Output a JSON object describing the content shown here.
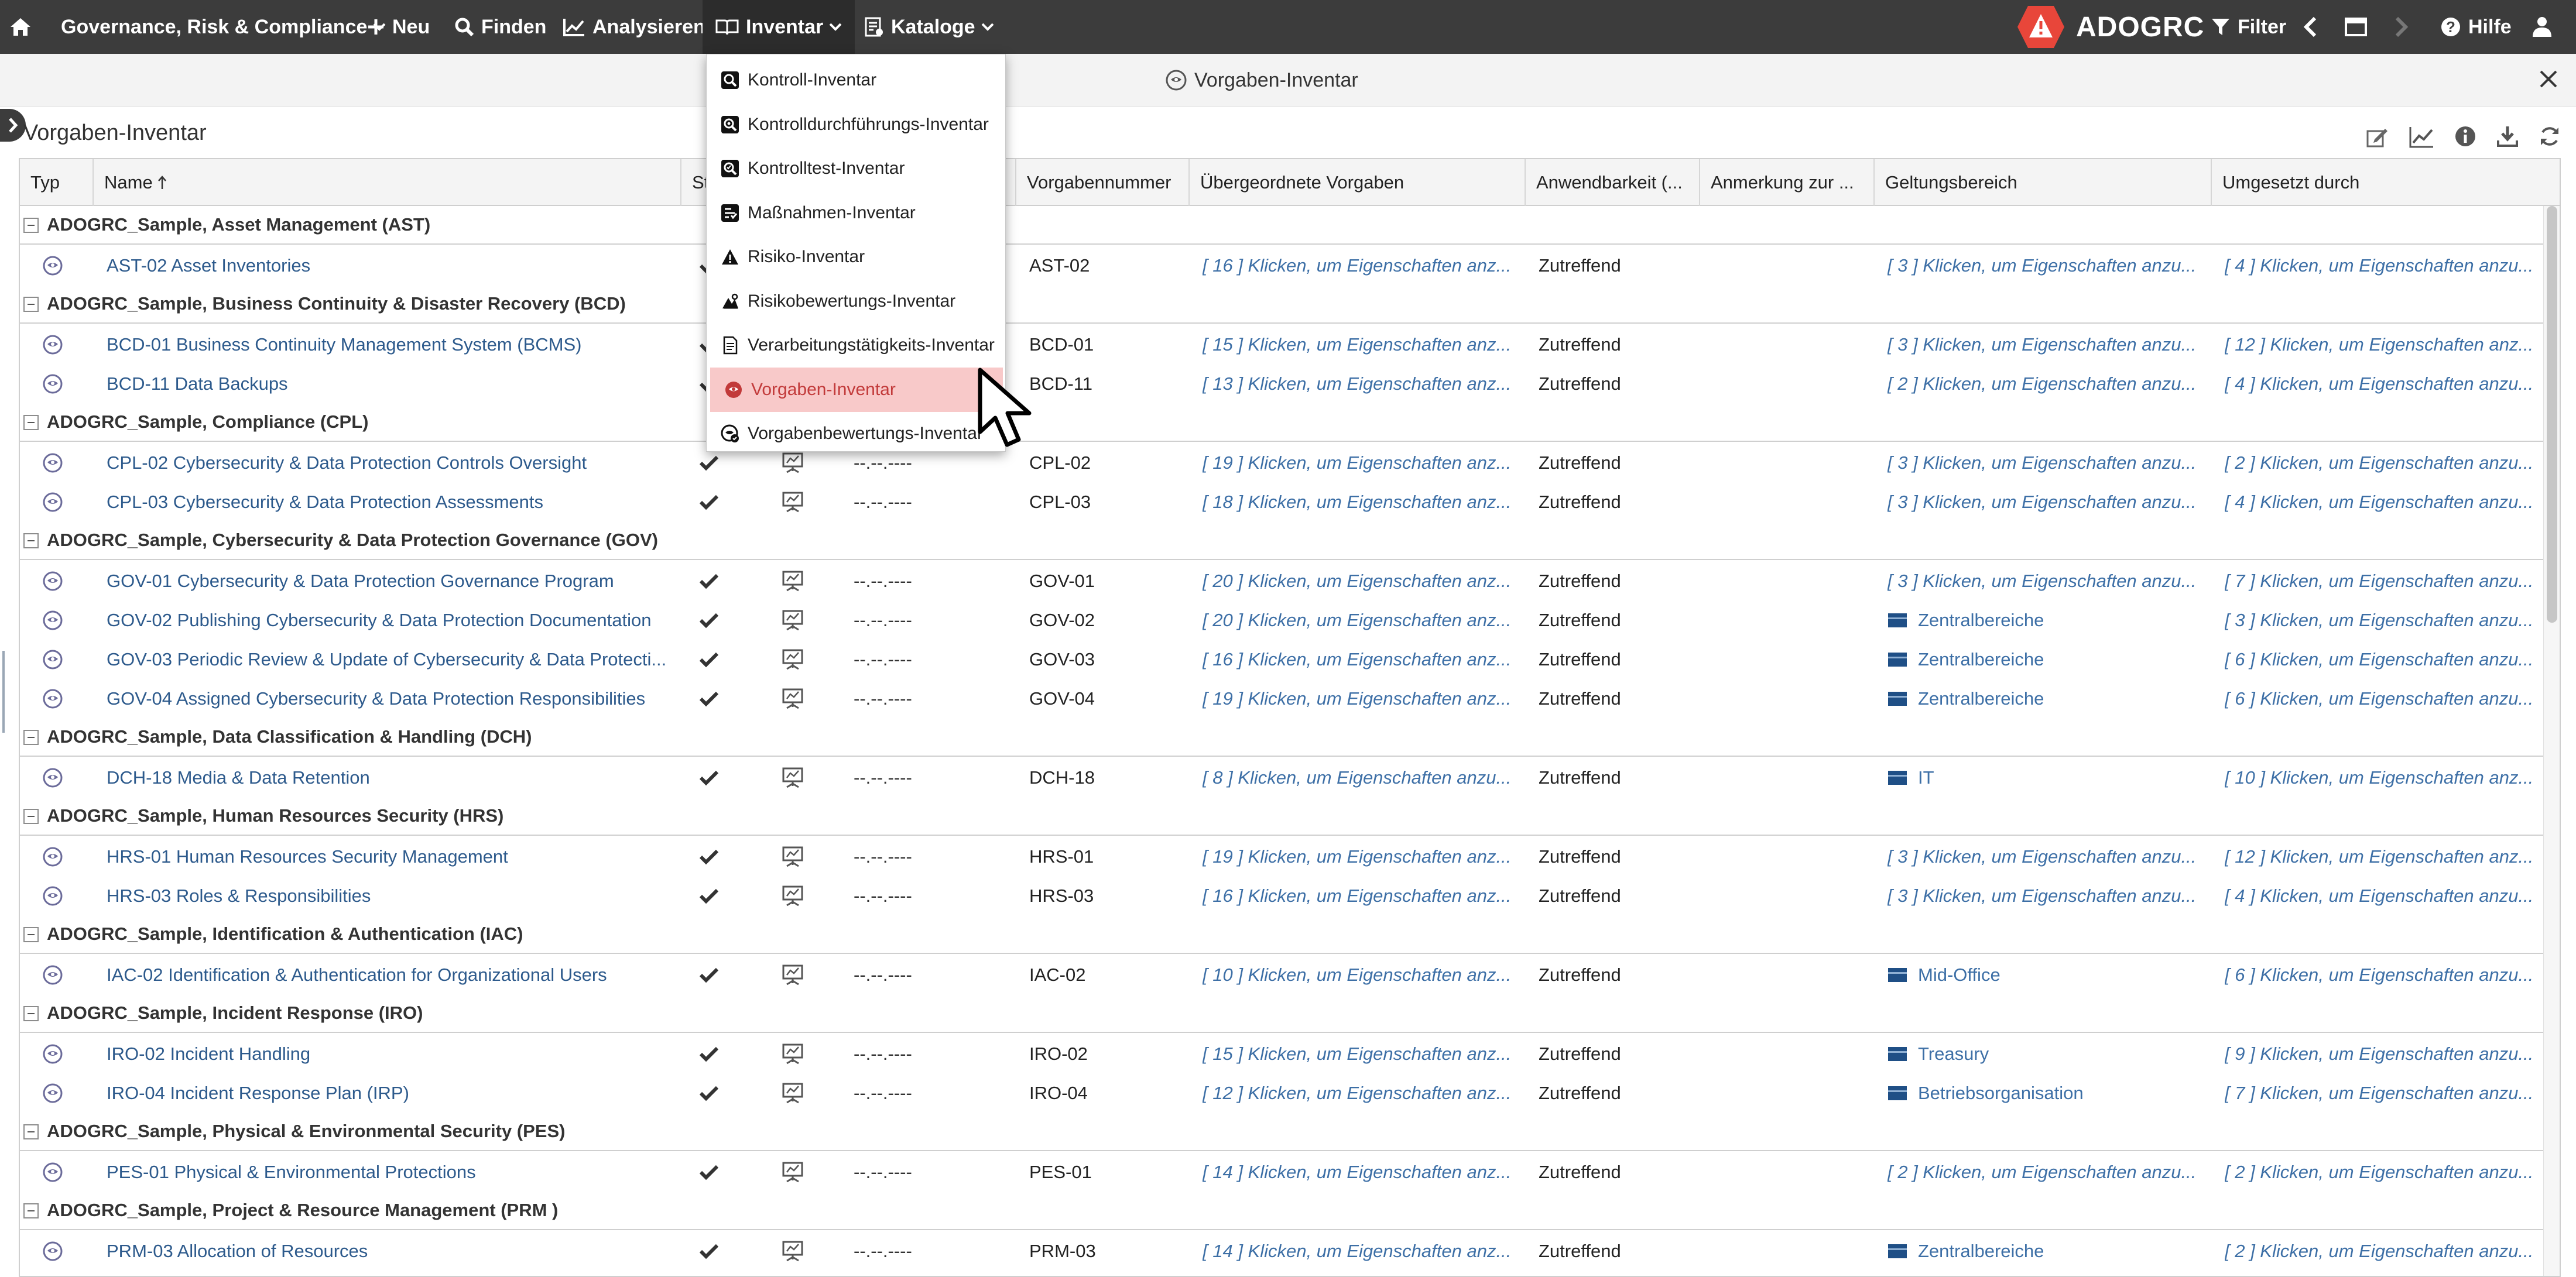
{
  "topbar": {
    "home_icon": "home-icon",
    "app_menu": "Governance, Risk & Compliance",
    "new": "Neu",
    "find": "Finden",
    "analyze": "Analysieren",
    "inventory": "Inventar",
    "catalogs": "Kataloge",
    "brand": "ADOGRC",
    "filter": "Filter",
    "help": "Hilfe"
  },
  "subheader": {
    "title": "Vorgaben-Inventar"
  },
  "panel": {
    "title": "Vorgaben-Inventar"
  },
  "dropdown": {
    "items": [
      {
        "label": "Kontroll-Inventar",
        "icon": "magnifier-icon"
      },
      {
        "label": "Kontrolldurchführungs-Inventar",
        "icon": "magnifier-gear-icon"
      },
      {
        "label": "Kontrolltest-Inventar",
        "icon": "magnifier-test-icon"
      },
      {
        "label": "Maßnahmen-Inventar",
        "icon": "measures-icon"
      },
      {
        "label": "Risiko-Inventar",
        "icon": "warning-icon"
      },
      {
        "label": "Risikobewertungs-Inventar",
        "icon": "risk-assessment-icon"
      },
      {
        "label": "Verarbeitungstätigkeits-Inventar",
        "icon": "document-icon"
      },
      {
        "label": "Vorgaben-Inventar",
        "icon": "requirement-icon",
        "active": true
      },
      {
        "label": "Vorgabenbewertungs-Inventar",
        "icon": "requirement-assessment-icon"
      }
    ]
  },
  "grid": {
    "columns": [
      "Typ",
      "Name",
      "Sta",
      "Vorgabennummer",
      "Übergeordnete Vorgaben",
      "Anwendbarkeit (...",
      "Anmerkung zur ...",
      "Geltungsbereich",
      "Umgesetzt durch"
    ],
    "groups": [
      {
        "label": "ADOGRC_Sample, Asset Management (AST)",
        "rows": [
          {
            "name": "AST-02 Asset Inventories",
            "status": true,
            "date": "--.--.----",
            "number": "AST-02",
            "parent": "[ 16 ] Klicken, um Eigenschaften anz...",
            "applicability": "Zutreffend",
            "scope": "[ 3 ] Klicken, um Eigenschaften anzu...",
            "scope_is_unit": false,
            "impl": "[ 4 ] Klicken, um Eigenschaften anzu..."
          }
        ]
      },
      {
        "label": "ADOGRC_Sample, Business Continuity & Disaster Recovery (BCD)",
        "rows": [
          {
            "name": "BCD-01 Business Continuity Management System (BCMS)",
            "status": true,
            "date": "--.--.----",
            "number": "BCD-01",
            "parent": "[ 15 ] Klicken, um Eigenschaften anz...",
            "applicability": "Zutreffend",
            "scope": "[ 3 ] Klicken, um Eigenschaften anzu...",
            "scope_is_unit": false,
            "impl": "[ 12 ] Klicken, um Eigenschaften anz..."
          },
          {
            "name": "BCD-11 Data Backups",
            "status": true,
            "date": "--.--.----",
            "number": "BCD-11",
            "parent": "[ 13 ] Klicken, um Eigenschaften anz...",
            "applicability": "Zutreffend",
            "scope": "[ 2 ] Klicken, um Eigenschaften anzu...",
            "scope_is_unit": false,
            "impl": "[ 4 ] Klicken, um Eigenschaften anzu..."
          }
        ]
      },
      {
        "label": "ADOGRC_Sample, Compliance (CPL)",
        "rows": [
          {
            "name": "CPL-02 Cybersecurity & Data Protection Controls Oversight",
            "status": true,
            "date": "--.--.----",
            "number": "CPL-02",
            "parent": "[ 19 ] Klicken, um Eigenschaften anz...",
            "applicability": "Zutreffend",
            "scope": "[ 3 ] Klicken, um Eigenschaften anzu...",
            "scope_is_unit": false,
            "impl": "[ 2 ] Klicken, um Eigenschaften anzu..."
          },
          {
            "name": "CPL-03 Cybersecurity & Data Protection Assessments",
            "status": true,
            "date": "--.--.----",
            "number": "CPL-03",
            "parent": "[ 18 ] Klicken, um Eigenschaften anz...",
            "applicability": "Zutreffend",
            "scope": "[ 3 ] Klicken, um Eigenschaften anzu...",
            "scope_is_unit": false,
            "impl": "[ 4 ] Klicken, um Eigenschaften anzu..."
          }
        ]
      },
      {
        "label": "ADOGRC_Sample, Cybersecurity & Data Protection Governance (GOV)",
        "rows": [
          {
            "name": "GOV-01 Cybersecurity & Data Protection Governance Program",
            "status": true,
            "date": "--.--.----",
            "number": "GOV-01",
            "parent": "[ 20 ] Klicken, um Eigenschaften anz...",
            "applicability": "Zutreffend",
            "scope": "[ 3 ] Klicken, um Eigenschaften anzu...",
            "scope_is_unit": false,
            "impl": "[ 7 ] Klicken, um Eigenschaften anzu..."
          },
          {
            "name": "GOV-02 Publishing Cybersecurity & Data Protection Documentation",
            "status": true,
            "date": "--.--.----",
            "number": "GOV-02",
            "parent": "[ 20 ] Klicken, um Eigenschaften anz...",
            "applicability": "Zutreffend",
            "scope": "Zentralbereiche",
            "scope_is_unit": true,
            "impl": "[ 3 ] Klicken, um Eigenschaften anzu..."
          },
          {
            "name": "GOV-03 Periodic Review & Update of Cybersecurity & Data Protecti...",
            "status": true,
            "date": "--.--.----",
            "number": "GOV-03",
            "parent": "[ 16 ] Klicken, um Eigenschaften anz...",
            "applicability": "Zutreffend",
            "scope": "Zentralbereiche",
            "scope_is_unit": true,
            "impl": "[ 6 ] Klicken, um Eigenschaften anzu..."
          },
          {
            "name": "GOV-04 Assigned Cybersecurity & Data Protection Responsibilities",
            "status": true,
            "date": "--.--.----",
            "number": "GOV-04",
            "parent": "[ 19 ] Klicken, um Eigenschaften anz...",
            "applicability": "Zutreffend",
            "scope": "Zentralbereiche",
            "scope_is_unit": true,
            "impl": "[ 6 ] Klicken, um Eigenschaften anzu..."
          }
        ]
      },
      {
        "label": "ADOGRC_Sample, Data Classification & Handling (DCH)",
        "rows": [
          {
            "name": "DCH-18 Media & Data Retention",
            "status": true,
            "date": "--.--.----",
            "number": "DCH-18",
            "parent": "[ 8 ] Klicken, um Eigenschaften anzu...",
            "applicability": "Zutreffend",
            "scope": "IT",
            "scope_is_unit": true,
            "impl": "[ 10 ] Klicken, um Eigenschaften anz..."
          }
        ]
      },
      {
        "label": "ADOGRC_Sample, Human Resources Security (HRS)",
        "rows": [
          {
            "name": "HRS-01 Human Resources Security Management",
            "status": true,
            "date": "--.--.----",
            "number": "HRS-01",
            "parent": "[ 19 ] Klicken, um Eigenschaften anz...",
            "applicability": "Zutreffend",
            "scope": "[ 3 ] Klicken, um Eigenschaften anzu...",
            "scope_is_unit": false,
            "impl": "[ 12 ] Klicken, um Eigenschaften anz..."
          },
          {
            "name": "HRS-03 Roles & Responsibilities",
            "status": true,
            "date": "--.--.----",
            "number": "HRS-03",
            "parent": "[ 16 ] Klicken, um Eigenschaften anz...",
            "applicability": "Zutreffend",
            "scope": "[ 3 ] Klicken, um Eigenschaften anzu...",
            "scope_is_unit": false,
            "impl": "[ 4 ] Klicken, um Eigenschaften anzu..."
          }
        ]
      },
      {
        "label": "ADOGRC_Sample, Identification & Authentication (IAC)",
        "rows": [
          {
            "name": "IAC-02 Identification & Authentication for Organizational Users",
            "status": true,
            "date": "--.--.----",
            "number": "IAC-02",
            "parent": "[ 10 ] Klicken, um Eigenschaften anz...",
            "applicability": "Zutreffend",
            "scope": "Mid-Office",
            "scope_is_unit": true,
            "impl": "[ 6 ] Klicken, um Eigenschaften anzu..."
          }
        ]
      },
      {
        "label": "ADOGRC_Sample, Incident Response (IRO)",
        "rows": [
          {
            "name": "IRO-02 Incident Handling",
            "status": true,
            "date": "--.--.----",
            "number": "IRO-02",
            "parent": "[ 15 ] Klicken, um Eigenschaften anz...",
            "applicability": "Zutreffend",
            "scope": "Treasury",
            "scope_is_unit": true,
            "impl": "[ 9 ] Klicken, um Eigenschaften anzu..."
          },
          {
            "name": "IRO-04 Incident Response Plan (IRP)",
            "status": true,
            "date": "--.--.----",
            "number": "IRO-04",
            "parent": "[ 12 ] Klicken, um Eigenschaften anz...",
            "applicability": "Zutreffend",
            "scope": "Betriebsorganisation",
            "scope_is_unit": true,
            "impl": "[ 7 ] Klicken, um Eigenschaften anzu..."
          }
        ]
      },
      {
        "label": "ADOGRC_Sample, Physical & Environmental Security (PES)",
        "rows": [
          {
            "name": "PES-01 Physical & Environmental Protections",
            "status": true,
            "date": "--.--.----",
            "number": "PES-01",
            "parent": "[ 14 ] Klicken, um Eigenschaften anz...",
            "applicability": "Zutreffend",
            "scope": "[ 2 ] Klicken, um Eigenschaften anzu...",
            "scope_is_unit": false,
            "impl": "[ 2 ] Klicken, um Eigenschaften anzu..."
          }
        ]
      },
      {
        "label": "ADOGRC_Sample, Project & Resource Management (PRM )",
        "rows": [
          {
            "name": "PRM-03 Allocation of Resources",
            "status": true,
            "date": "--.--.----",
            "number": "PRM-03",
            "parent": "[ 14 ] Klicken, um Eigenschaften anz...",
            "applicability": "Zutreffend",
            "scope": "Zentralbereiche",
            "scope_is_unit": true,
            "impl": "[ 2 ] Klicken, um Eigenschaften anzu..."
          }
        ]
      }
    ]
  },
  "colors": {
    "topbar": "#3c3c3c",
    "brand": "#e8463a",
    "link": "#2d5a8c",
    "active_menu_bg": "#f8c9c9"
  }
}
